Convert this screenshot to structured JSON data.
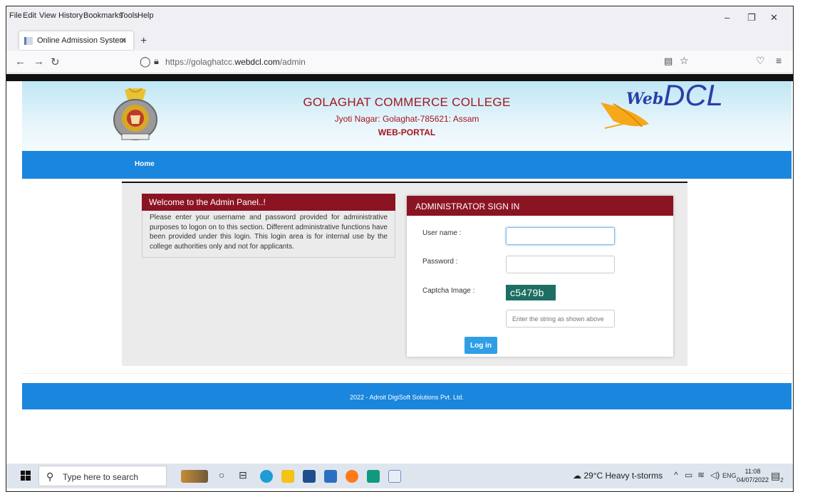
{
  "browser": {
    "menu": [
      "File",
      "Edit",
      "View",
      "History",
      "Bookmarks",
      "Tools",
      "Help"
    ],
    "tab_title": "Online Admission System",
    "url_prefix": "https://golaghatcc.",
    "url_domain": "webdcl.com",
    "url_path": "/admin"
  },
  "header": {
    "college_name": "GOLAGHAT COMMERCE COLLEGE",
    "address": "Jyoti Nagar: Golaghat-785621: Assam",
    "portal": "WEB-PORTAL",
    "brand": "Web DCL"
  },
  "nav": {
    "home": "Home"
  },
  "welcome": {
    "title": "Welcome to the Admin Panel..!",
    "text": "Please enter your username and password provided for administrative purposes to logon on to this section. Different administrative functions have been provided under this login. This login area is for internal use by the college authorities only and not for applicants."
  },
  "login": {
    "title": "ADMINISTRATOR SIGN IN",
    "username_label": "User name :",
    "password_label": "Password :",
    "captcha_label": "Captcha Image :",
    "captcha_text": "c5479b",
    "captcha_placeholder": "Enter the string as shown above",
    "button": "Log in"
  },
  "footer": {
    "text": "2022 - Adroit DigiSoft Solutions Pvt. Ltd."
  },
  "taskbar": {
    "search_placeholder": "Type here to search",
    "weather": "29°C  Heavy t-storms",
    "lang": "ENG",
    "time": "11:08",
    "date": "04/07/2022",
    "notif_count": "2"
  },
  "colors": {
    "maroon": "#8b1423",
    "blue": "#1a86dd",
    "captcha": "#1e6e63"
  }
}
